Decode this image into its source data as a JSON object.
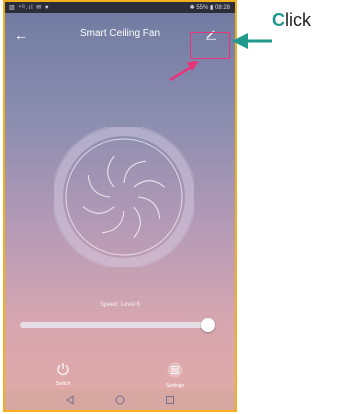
{
  "status_bar": {
    "left": "▥ ⁴ᴳ.ıl ✉ ♥",
    "right": "✱ 55% ▮ 08:28"
  },
  "header": {
    "back_icon": "back-arrow-icon",
    "title": "Smart Ceiling Fan",
    "edit_icon": "pencil-icon"
  },
  "fan": {
    "icon": "fan-blades-icon"
  },
  "speed": {
    "label": "Speed: Level 6",
    "level_fraction": 0.99
  },
  "bottom": {
    "switch_label": "Switch",
    "switch_icon": "power-icon",
    "settings_label": "Settings",
    "settings_icon": "settings-icon"
  },
  "nav": [
    "back-triangle-icon",
    "home-circle-icon",
    "recents-square-icon"
  ],
  "annotation": {
    "first_letter": "C",
    "rest": "lick",
    "color": "#1e9a8c",
    "highlight_color": "#e8337b"
  }
}
